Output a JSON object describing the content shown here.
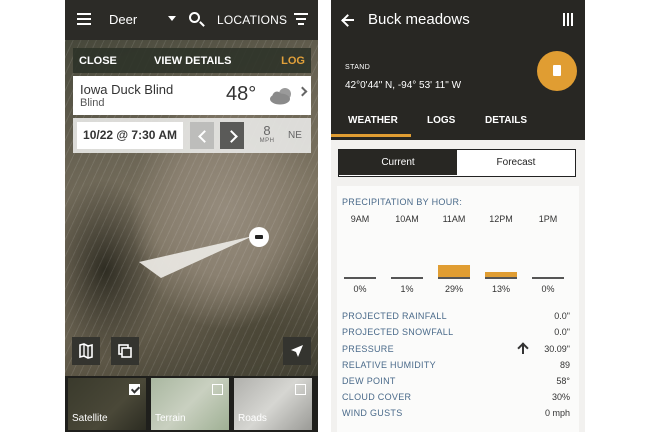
{
  "left_screen": {
    "topbar": {
      "species": "Deer",
      "locations_label": "LOCATIONS"
    },
    "action_bar": {
      "close_label": "CLOSE",
      "view_details_label": "VIEW DETAILS",
      "log_label": "LOG"
    },
    "location_card": {
      "name": "Iowa Duck Blind",
      "type": "Blind",
      "temperature": "48°",
      "weather_icon": "partly-cloudy-icon"
    },
    "date_bar": {
      "datetime": "10/22 @ 7:30 AM",
      "wind_speed": "8",
      "wind_unit": "MPH",
      "wind_direction": "NE"
    },
    "map_layers": [
      {
        "label": "Satellite",
        "checked": true
      },
      {
        "label": "Terrain",
        "checked": false
      },
      {
        "label": "Roads",
        "checked": false
      }
    ]
  },
  "right_screen": {
    "header": {
      "title": "Buck meadows",
      "subtitle": "STAND",
      "coordinates": "42°0'44\" N, -94° 53' 11\" W"
    },
    "tabs": [
      {
        "label": "WEATHER",
        "active": true
      },
      {
        "label": "LOGS",
        "active": false
      },
      {
        "label": "DETAILS",
        "active": false
      }
    ],
    "segment": {
      "current_label": "Current",
      "forecast_label": "Forecast",
      "selected": "Current"
    },
    "precipitation": {
      "title": "PRECIPITATION BY HOUR:",
      "hours": [
        "9AM",
        "10AM",
        "11AM",
        "12PM",
        "1PM"
      ],
      "percents": [
        "0%",
        "1%",
        "29%",
        "13%",
        "0%"
      ],
      "values": [
        0,
        1,
        29,
        13,
        0
      ]
    },
    "conditions": [
      {
        "label": "PROJECTED RAINFALL",
        "value": "0.0\""
      },
      {
        "label": "PROJECTED SNOWFALL",
        "value": "0.0\""
      },
      {
        "label": "PRESSURE",
        "value": "30.09\"",
        "trend": "up"
      },
      {
        "label": "RELATIVE HUMIDITY",
        "value": "89"
      },
      {
        "label": "DEW POINT",
        "value": "58°"
      },
      {
        "label": "CLOUD COVER",
        "value": "30%"
      },
      {
        "label": "WIND GUSTS",
        "value": "0 mph"
      }
    ],
    "accent_color": "#e09d32"
  }
}
